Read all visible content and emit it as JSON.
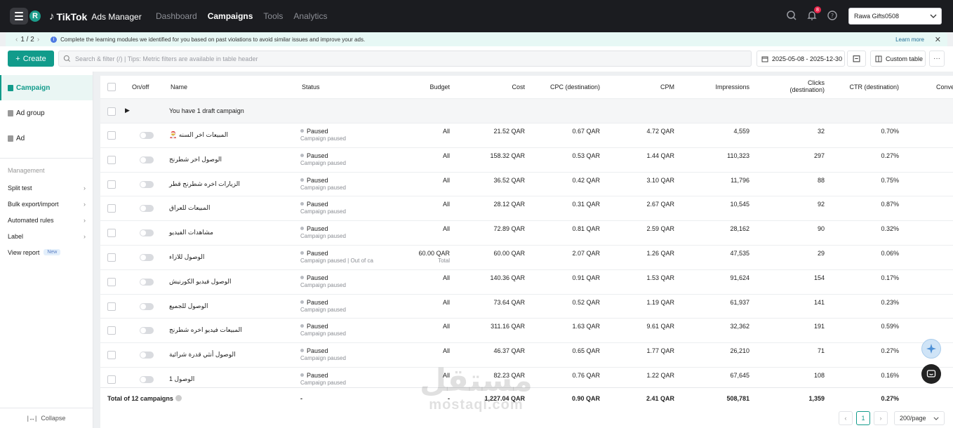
{
  "topbar": {
    "avatar_initial": "R",
    "logo_brand": "TikTok",
    "logo_product": "Ads Manager",
    "nav": [
      "Dashboard",
      "Campaigns",
      "Tools",
      "Analytics"
    ],
    "notifications_count": "8",
    "account_name": "Rawa Gifts0508"
  },
  "banner": {
    "pager": "1 / 2",
    "message": "Complete the learning modules we identified for you based on past violations to avoid similar issues and improve your ads.",
    "learn_more": "Learn more"
  },
  "toolbar": {
    "create_label": "Create",
    "search_placeholder": "Search & filter (/) | Tips: Metric filters are available in table header",
    "date_range": "2025-05-08 - 2025-12-30",
    "custom_table": "Custom table",
    "more": "···"
  },
  "sidebar": {
    "levels": [
      "Campaign",
      "Ad group",
      "Ad"
    ],
    "management_title": "Management",
    "management_items": [
      "Split test",
      "Bulk export/import",
      "Automated rules",
      "Label",
      "View report"
    ],
    "new_badge": "New",
    "collapse_label": "Collapse"
  },
  "table": {
    "headers": {
      "onoff": "On/off",
      "name": "Name",
      "status": "Status",
      "budget": "Budget",
      "cost": "Cost",
      "cpc": "CPC (destination)",
      "cpm": "CPM",
      "impressions": "Impressions",
      "clicks_line1": "Clicks",
      "clicks_line2": "(destination)",
      "ctr": "CTR (destination)",
      "conv": "Conve"
    },
    "draft_text": "You have 1 draft campaign",
    "rows": [
      {
        "name": "المبيعات اخر السنه 🎅",
        "status": "Paused",
        "sub": "Campaign paused",
        "budget": "All",
        "budget_sub": "",
        "cost": "21.52 QAR",
        "cpc": "0.67 QAR",
        "cpm": "4.72 QAR",
        "impressions": "4,559",
        "clicks": "32",
        "ctr": "0.70%"
      },
      {
        "name": "الوصول اخر شطرنج",
        "status": "Paused",
        "sub": "Campaign paused",
        "budget": "All",
        "budget_sub": "",
        "cost": "158.32 QAR",
        "cpc": "0.53 QAR",
        "cpm": "1.44 QAR",
        "impressions": "110,323",
        "clicks": "297",
        "ctr": "0.27%"
      },
      {
        "name": "الزيارات اخره شطرنج قطر",
        "status": "Paused",
        "sub": "Campaign paused",
        "budget": "All",
        "budget_sub": "",
        "cost": "36.52 QAR",
        "cpc": "0.42 QAR",
        "cpm": "3.10 QAR",
        "impressions": "11,796",
        "clicks": "88",
        "ctr": "0.75%"
      },
      {
        "name": "المبيعات للعراق",
        "status": "Paused",
        "sub": "Campaign paused",
        "budget": "All",
        "budget_sub": "",
        "cost": "28.12 QAR",
        "cpc": "0.31 QAR",
        "cpm": "2.67 QAR",
        "impressions": "10,545",
        "clicks": "92",
        "ctr": "0.87%"
      },
      {
        "name": "مشاهدات الفيديو",
        "status": "Paused",
        "sub": "Campaign paused",
        "budget": "All",
        "budget_sub": "",
        "cost": "72.89 QAR",
        "cpc": "0.81 QAR",
        "cpm": "2.59 QAR",
        "impressions": "28,162",
        "clicks": "90",
        "ctr": "0.32%"
      },
      {
        "name": "الوصول للازاء",
        "status": "Paused",
        "sub": "Campaign paused | Out of ca",
        "budget": "60.00 QAR",
        "budget_sub": "Total",
        "cost": "60.00 QAR",
        "cpc": "2.07 QAR",
        "cpm": "1.26 QAR",
        "impressions": "47,535",
        "clicks": "29",
        "ctr": "0.06%"
      },
      {
        "name": "الوصول فيديو الكورنيش",
        "status": "Paused",
        "sub": "Campaign paused",
        "budget": "All",
        "budget_sub": "",
        "cost": "140.36 QAR",
        "cpc": "0.91 QAR",
        "cpm": "1.53 QAR",
        "impressions": "91,624",
        "clicks": "154",
        "ctr": "0.17%"
      },
      {
        "name": "الوصول للجميع",
        "status": "Paused",
        "sub": "Campaign paused",
        "budget": "All",
        "budget_sub": "",
        "cost": "73.64 QAR",
        "cpc": "0.52 QAR",
        "cpm": "1.19 QAR",
        "impressions": "61,937",
        "clicks": "141",
        "ctr": "0.23%"
      },
      {
        "name": "المبيعات فيديو اخره شطرنج",
        "status": "Paused",
        "sub": "Campaign paused",
        "budget": "All",
        "budget_sub": "",
        "cost": "311.16 QAR",
        "cpc": "1.63 QAR",
        "cpm": "9.61 QAR",
        "impressions": "32,362",
        "clicks": "191",
        "ctr": "0.59%"
      },
      {
        "name": "الوصول أنثي قدرة شرائية",
        "status": "Paused",
        "sub": "Campaign paused",
        "budget": "All",
        "budget_sub": "",
        "cost": "46.37 QAR",
        "cpc": "0.65 QAR",
        "cpm": "1.77 QAR",
        "impressions": "26,210",
        "clicks": "71",
        "ctr": "0.27%"
      },
      {
        "name": "الوصول 1",
        "status": "Paused",
        "sub": "Campaign paused",
        "budget": "All",
        "budget_sub": "",
        "cost": "82.23 QAR",
        "cpc": "0.76 QAR",
        "cpm": "1.22 QAR",
        "impressions": "67,645",
        "clicks": "108",
        "ctr": "0.16%"
      }
    ],
    "total": {
      "label": "Total of 12 campaigns",
      "status": "-",
      "budget": "-",
      "cost": "1,227.04 QAR",
      "cpc": "0.90 QAR",
      "cpm": "2.41 QAR",
      "impressions": "508,781",
      "clicks": "1,359",
      "ctr": "0.27%"
    }
  },
  "pagination": {
    "current_page": "1",
    "page_size": "200/page"
  },
  "watermark": {
    "arabic": "مستقل",
    "latin": "mostaql.com"
  }
}
